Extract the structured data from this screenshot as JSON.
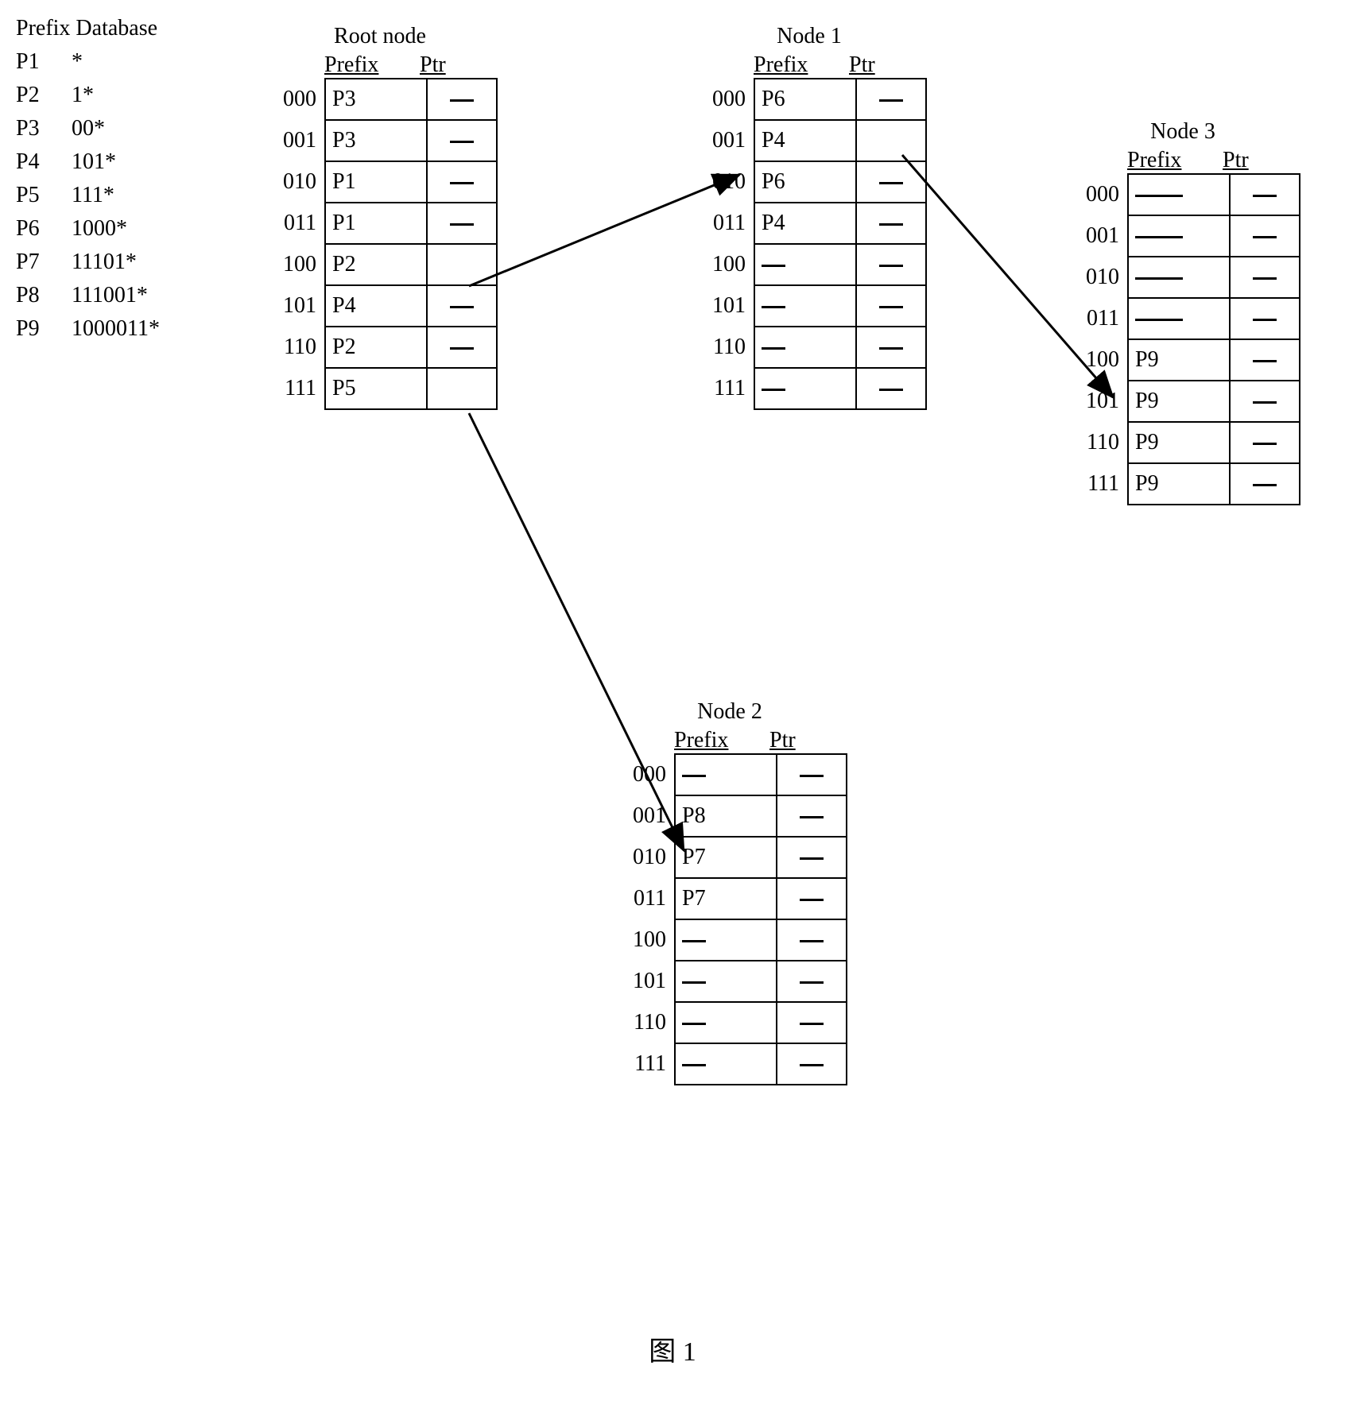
{
  "prefix_database": {
    "title": "Prefix Database",
    "rows": [
      {
        "name": "P1",
        "value": "*"
      },
      {
        "name": "P2",
        "value": "1*"
      },
      {
        "name": "P3",
        "value": "00*"
      },
      {
        "name": "P4",
        "value": "101*"
      },
      {
        "name": "P5",
        "value": "111*"
      },
      {
        "name": "P6",
        "value": "1000*"
      },
      {
        "name": "P7",
        "value": "11101*"
      },
      {
        "name": "P8",
        "value": "111001*"
      },
      {
        "name": "P9",
        "value": "1000011*"
      }
    ]
  },
  "headers": {
    "prefix": "Prefix",
    "ptr": "Ptr"
  },
  "indices": [
    "000",
    "001",
    "010",
    "011",
    "100",
    "101",
    "110",
    "111"
  ],
  "nodes": {
    "root": {
      "title": "Root node",
      "rows": [
        {
          "prefix": "P3",
          "ptr": "dash"
        },
        {
          "prefix": "P3",
          "ptr": "dash"
        },
        {
          "prefix": "P1",
          "ptr": "dash"
        },
        {
          "prefix": "P1",
          "ptr": "dash"
        },
        {
          "prefix": "P2",
          "ptr": "arrow1"
        },
        {
          "prefix": "P4",
          "ptr": "dash"
        },
        {
          "prefix": "P2",
          "ptr": "dash"
        },
        {
          "prefix": "P5",
          "ptr": "arrow2"
        }
      ]
    },
    "node1": {
      "title": "Node 1",
      "rows": [
        {
          "prefix": "P6",
          "ptr": "dash"
        },
        {
          "prefix": "P4",
          "ptr": "arrow3"
        },
        {
          "prefix": "P6",
          "ptr": "dash"
        },
        {
          "prefix": "P4",
          "ptr": "dash"
        },
        {
          "prefix": "dash",
          "ptr": "dash"
        },
        {
          "prefix": "dash",
          "ptr": "dash"
        },
        {
          "prefix": "dash",
          "ptr": "dash"
        },
        {
          "prefix": "dash",
          "ptr": "dash"
        }
      ]
    },
    "node2": {
      "title": "Node 2",
      "rows": [
        {
          "prefix": "dash",
          "ptr": "dash"
        },
        {
          "prefix": "P8",
          "ptr": "dash"
        },
        {
          "prefix": "P7",
          "ptr": "dash"
        },
        {
          "prefix": "P7",
          "ptr": "dash"
        },
        {
          "prefix": "dash",
          "ptr": "dash"
        },
        {
          "prefix": "dash",
          "ptr": "dash"
        },
        {
          "prefix": "dash",
          "ptr": "dash"
        },
        {
          "prefix": "dash",
          "ptr": "dash"
        }
      ]
    },
    "node3": {
      "title": "Node 3",
      "rows": [
        {
          "prefix": "dashlong",
          "ptr": "dash"
        },
        {
          "prefix": "dashlong",
          "ptr": "dash"
        },
        {
          "prefix": "dashlong",
          "ptr": "dash"
        },
        {
          "prefix": "dashlong",
          "ptr": "dash"
        },
        {
          "prefix": "P9",
          "ptr": "dash"
        },
        {
          "prefix": "P9",
          "ptr": "dash"
        },
        {
          "prefix": "P9",
          "ptr": "dash"
        },
        {
          "prefix": "P9",
          "ptr": "dash"
        }
      ]
    }
  },
  "caption": "图 1"
}
